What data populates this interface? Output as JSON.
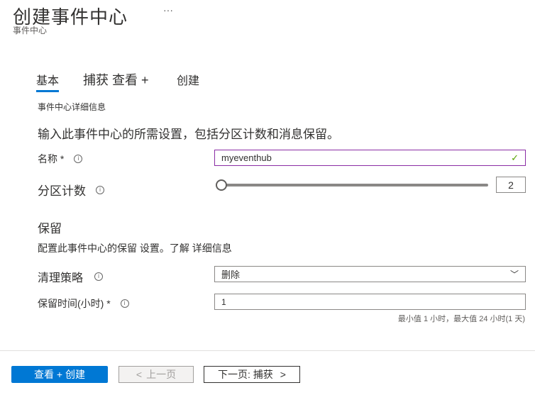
{
  "header": {
    "title": "创建事件中心",
    "more": "···",
    "subtitle": "事件中心"
  },
  "tabs": [
    {
      "label": "基本"
    },
    {
      "label": "捕获 查看 +"
    },
    {
      "label": "创建"
    }
  ],
  "section": {
    "heading": "事件中心详细信息",
    "description": "输入此事件中心的所需设置，包括分区计数和消息保留。"
  },
  "fields": {
    "name": {
      "label": "名称 *",
      "value": "myeventhub"
    },
    "partition": {
      "label": "分区计数",
      "value": "2",
      "slider_fraction": 0.0
    },
    "retention_heading": "保留",
    "retention_desc": "配置此事件中心的保留 设置。了解 详细信息",
    "cleanup": {
      "label": "清理策略",
      "value": "删除"
    },
    "retention_time": {
      "label": "保留时间(小时) *",
      "value": "1",
      "hint": "最小值 1 小时，最大值 24 小时(1 天)"
    }
  },
  "footer": {
    "review_create": "查看 + 创建",
    "previous": "上一页",
    "prev_arrow": "<",
    "next": "下一页: 捕获",
    "next_arrow": ">"
  },
  "colors": {
    "accent": "#0078d4",
    "valid_border": "#8a2da5",
    "check": "#57a300"
  }
}
